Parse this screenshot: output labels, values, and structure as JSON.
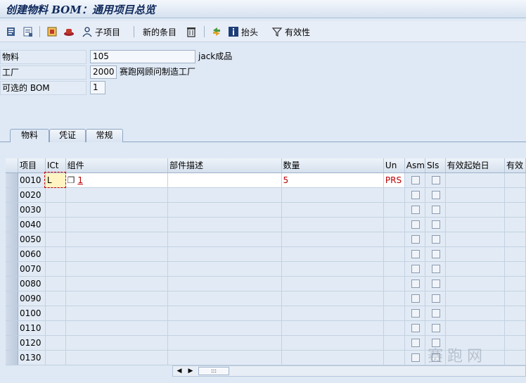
{
  "title": "创建物料 BOM：通用项目总览",
  "toolbar": {
    "subitem_label": "子项目",
    "new_entries_label": "新的条目",
    "header_label": "抬头",
    "validity_label": "有效性"
  },
  "form": {
    "material_label": "物料",
    "material_value": "105",
    "material_desc": "jack成品",
    "plant_label": "工厂",
    "plant_value": "2000",
    "plant_desc": "赛跑网顾问制造工厂",
    "altbom_label": "可选的 BOM",
    "altbom_value": "1"
  },
  "tabs": [
    "物料",
    "凭证",
    "常规"
  ],
  "table": {
    "headers": [
      "项目",
      "ICt",
      "组件",
      "部件描述",
      "数量",
      "Un",
      "Asm",
      "SIs",
      "有效起始日",
      "有效"
    ],
    "rows": [
      {
        "item": "0010",
        "ict": "L",
        "component": "1",
        "desc": "",
        "qty": "5",
        "un": "PRS"
      },
      {
        "item": "0020"
      },
      {
        "item": "0030"
      },
      {
        "item": "0040"
      },
      {
        "item": "0050"
      },
      {
        "item": "0060"
      },
      {
        "item": "0070"
      },
      {
        "item": "0080"
      },
      {
        "item": "0090"
      },
      {
        "item": "0100"
      },
      {
        "item": "0110"
      },
      {
        "item": "0120"
      },
      {
        "item": "0130"
      }
    ]
  },
  "watermark": "赛跑网"
}
